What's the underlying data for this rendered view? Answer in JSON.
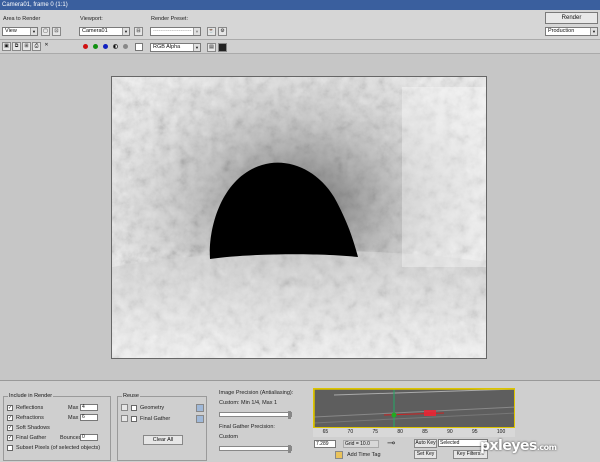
{
  "window": {
    "title": "Camera01, frame 0 (1:1)"
  },
  "toolbar": {
    "area_label": "Area to Render",
    "area_value": "View",
    "viewport_label": "Viewport:",
    "viewport_value": "Camera01",
    "preset_label": "Render Preset:",
    "preset_value": "---------------------",
    "render_button": "Render",
    "production_value": "Production",
    "channel_value": "RGB Alpha"
  },
  "colors": {
    "red": "#d01010",
    "green": "#109010",
    "blue": "#1020c0",
    "accent": "#dcc400"
  },
  "include": {
    "title": "Include in Render",
    "reflections": "Reflections",
    "refractions": "Refractions",
    "soft_shadows": "Soft Shadows",
    "final_gather": "Final Gather",
    "max_label": "Max",
    "max_reflect": "4",
    "max_refract": "6",
    "bounces_label": "Bounces",
    "bounces": "0",
    "subset": "Subset Pixels (of selected objects)"
  },
  "reuse": {
    "title": "Reuse",
    "geometry": "Geometry",
    "final_gather": "Final Gather",
    "clear_all": "Clear All"
  },
  "precision": {
    "title": "Image Precision (Antialiasing):",
    "value": "Custom: Min 1/4, Max 1",
    "fg_title": "Final Gather Precision:",
    "fg_value": "Custom"
  },
  "timeline": {
    "ticks": [
      "65",
      "70",
      "75",
      "80",
      "85",
      "90",
      "95",
      "100"
    ]
  },
  "status": {
    "coord": "7.289",
    "grid": "Grid = 10.0",
    "add_time_tag": "Add Time Tag",
    "auto_key": "Auto Key",
    "selected": "Selected",
    "set_key": "Set Key",
    "key_filters": "Key Filters..."
  },
  "watermark": {
    "brand": "pxleyes",
    "tld": ".com"
  }
}
